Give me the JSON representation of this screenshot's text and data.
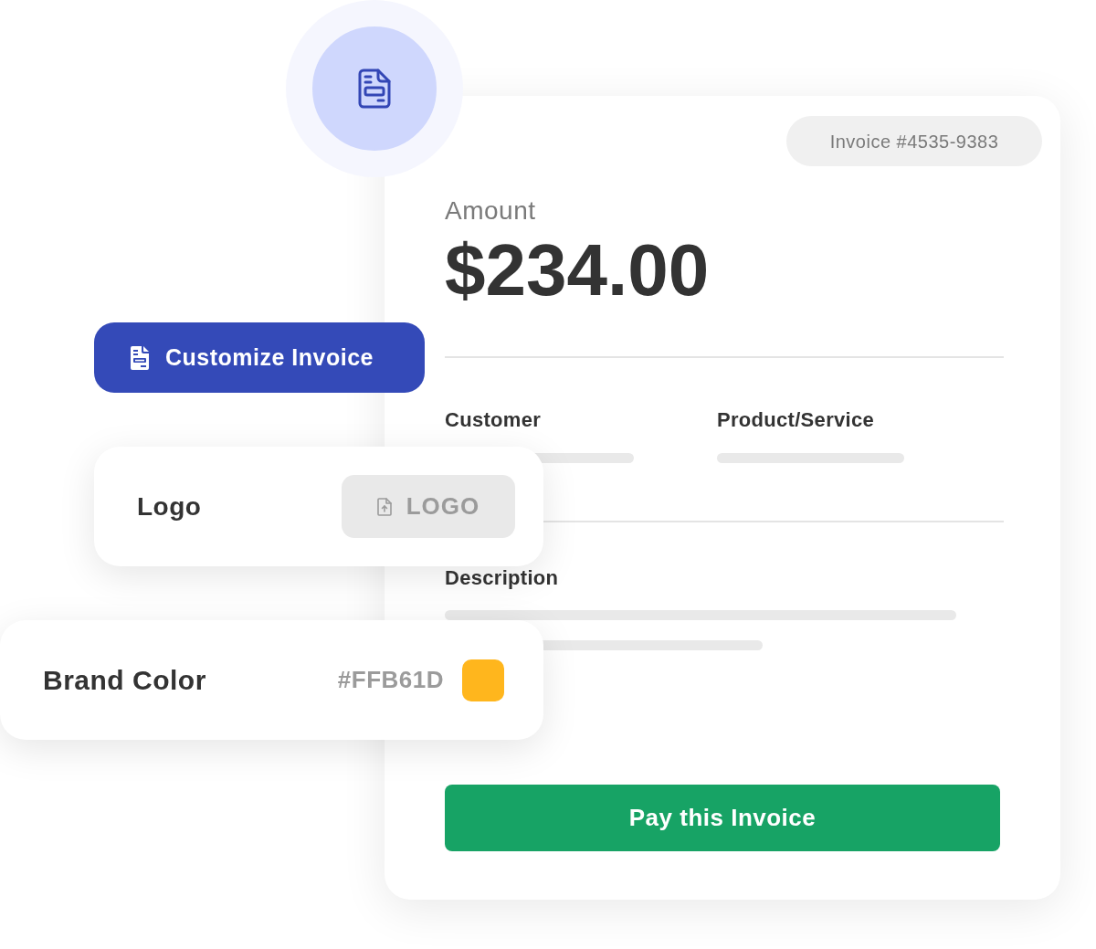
{
  "invoice": {
    "number": "Invoice #4535-9383",
    "amount_label": "Amount",
    "amount": "$234.00",
    "fields": [
      {
        "label": "Customer"
      },
      {
        "label": "Product/Service"
      }
    ],
    "description_label": "Description",
    "pay_button": "Pay this Invoice"
  },
  "customize_button": {
    "label": "Customize Invoice"
  },
  "logo_card": {
    "label": "Logo",
    "upload_button": "LOGO"
  },
  "brand_color_card": {
    "label": "Brand Color",
    "value": "#FFB61D",
    "color": "#ffb61d"
  }
}
